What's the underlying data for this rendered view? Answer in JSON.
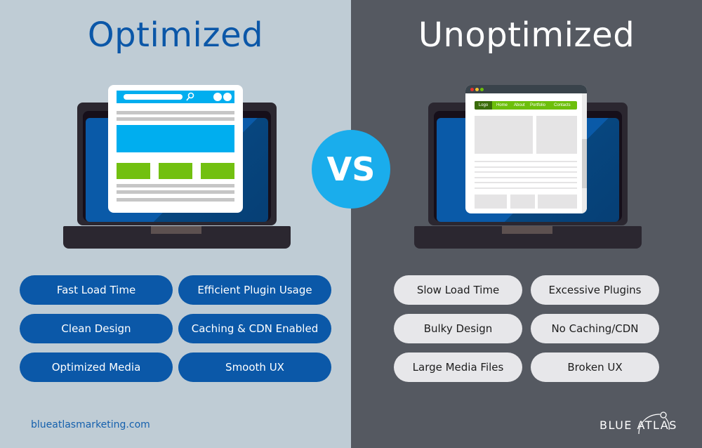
{
  "left": {
    "title": "Optimized",
    "features": [
      "Fast Load Time",
      "Efficient Plugin Usage",
      "Clean Design",
      "Caching & CDN Enabled",
      "Optimized Media",
      "Smooth UX"
    ],
    "footer_url": "blueatlasmarketing.com"
  },
  "right": {
    "title": "Unoptimized",
    "features": [
      "Slow Load Time",
      "Excessive Plugins",
      "Bulky Design",
      "No Caching/CDN",
      "Large Media Files",
      "Broken UX"
    ],
    "mock_nav": {
      "logo": "Logo",
      "links": [
        "Home",
        "About",
        "Portfolio",
        "Contacts"
      ]
    }
  },
  "vs_label": "VS",
  "brand": {
    "logo_text": "BLUE ATLAS"
  },
  "colors": {
    "left_bg": "#bfccd5",
    "right_bg": "#555961",
    "brand_blue": "#0b58a8",
    "accent_cyan": "#1aadec",
    "accent_green": "#72c010",
    "pill_gray": "#e7e7ea"
  }
}
